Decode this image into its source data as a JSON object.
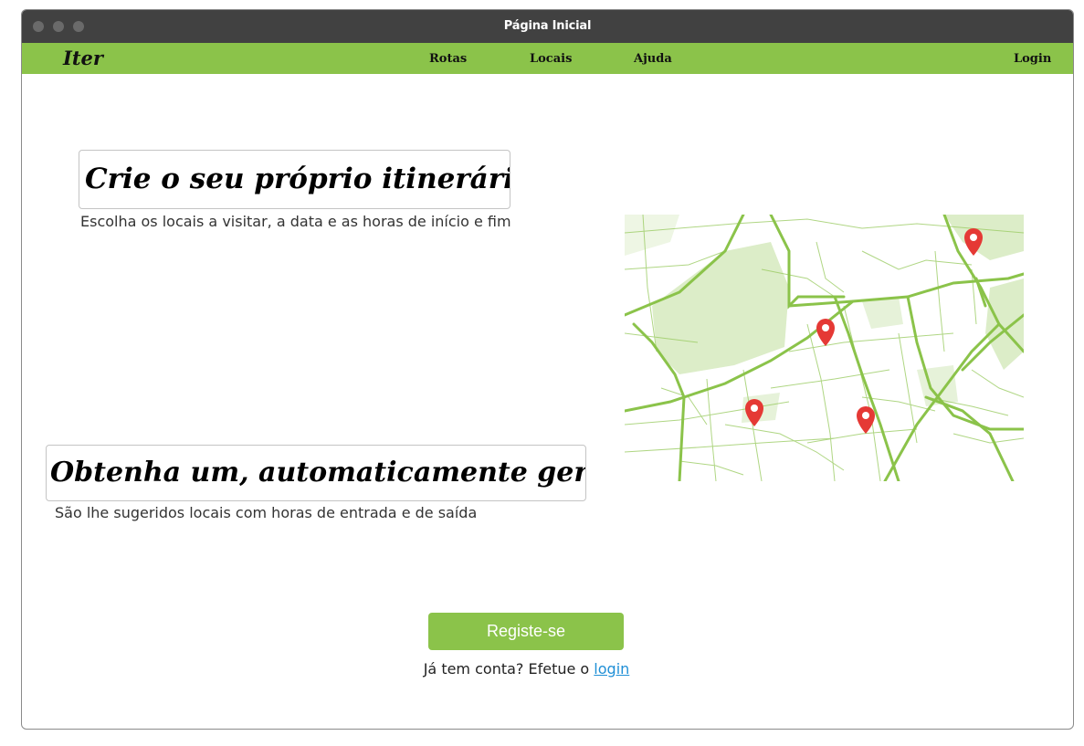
{
  "window": {
    "title": "Página Inicial"
  },
  "nav": {
    "brand": "Iter",
    "links": [
      "Rotas",
      "Locais",
      "Ajuda"
    ],
    "login": "Login"
  },
  "section1": {
    "heading": "Crie o seu próprio itinerário...",
    "subtext": "Escolha os locais a visitar, a data e as horas de início e fim"
  },
  "section2": {
    "heading": "Obtenha um, automaticamente gerado...",
    "subtext": "São lhe sugeridos locais com horas de entrada e de saída"
  },
  "map": {
    "icon": "map-illustration",
    "pin_color": "#e53935",
    "road_color": "#8bc34a",
    "park_color": "#dcedc8"
  },
  "cta": {
    "register_label": "Registe-se",
    "login_prompt": "Já tem conta? Efetue o",
    "login_link": "login"
  },
  "colors": {
    "accent": "#8bc34a",
    "titlebar": "#414141",
    "link": "#1f8fd6"
  }
}
